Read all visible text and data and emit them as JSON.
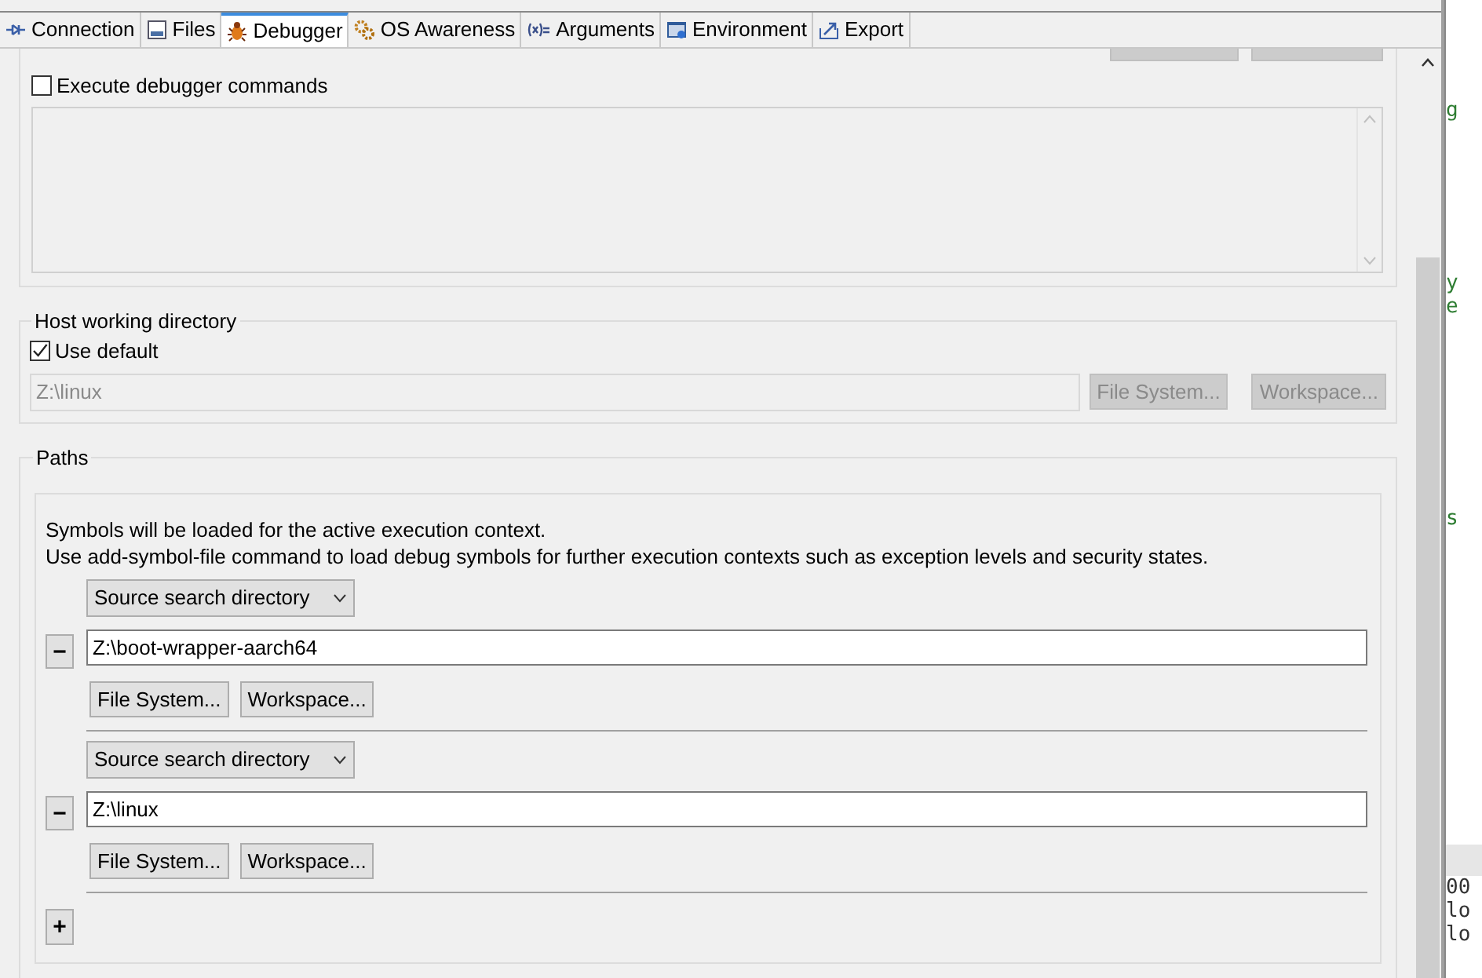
{
  "tabs": [
    {
      "label": "Connection",
      "selected": false
    },
    {
      "label": "Files",
      "selected": false
    },
    {
      "label": "Debugger",
      "selected": true
    },
    {
      "label": "OS Awareness",
      "selected": false
    },
    {
      "label": "Arguments",
      "selected": false
    },
    {
      "label": "Environment",
      "selected": false
    },
    {
      "label": "Export",
      "selected": false
    }
  ],
  "debugger_commands": {
    "label": "Execute debugger commands",
    "checked": false
  },
  "host_working_directory": {
    "title": "Host working directory",
    "use_default": {
      "label": "Use default",
      "checked": true
    },
    "value": "Z:\\linux",
    "disabled": true,
    "buttons": [
      "File System...",
      "Workspace..."
    ]
  },
  "paths": {
    "title": "Paths",
    "info": [
      "Symbols will be loaded for the active execution context.",
      "Use add-symbol-file command to load debug symbols for further execution contexts such as exception levels and security states."
    ],
    "entries": [
      {
        "type": "Source search directory",
        "remove": "−",
        "value": "Z:\\boot-wrapper-aarch64",
        "buttons": [
          "File System...",
          "Workspace..."
        ]
      },
      {
        "type": "Source search directory",
        "remove": "−",
        "value": "Z:\\linux",
        "buttons": [
          "File System...",
          "Workspace..."
        ]
      }
    ],
    "add": "+"
  },
  "background_editor": {
    "fragments": [
      {
        "text": "g",
        "color": "#2e7d32"
      },
      {
        "text": "y",
        "color": "#2e7d32"
      },
      {
        "text": "e",
        "color": "#2e7d32"
      },
      {
        "text": "s",
        "color": "#2e7d32"
      }
    ],
    "console_lines": [
      "00",
      "lo",
      "lo"
    ]
  }
}
